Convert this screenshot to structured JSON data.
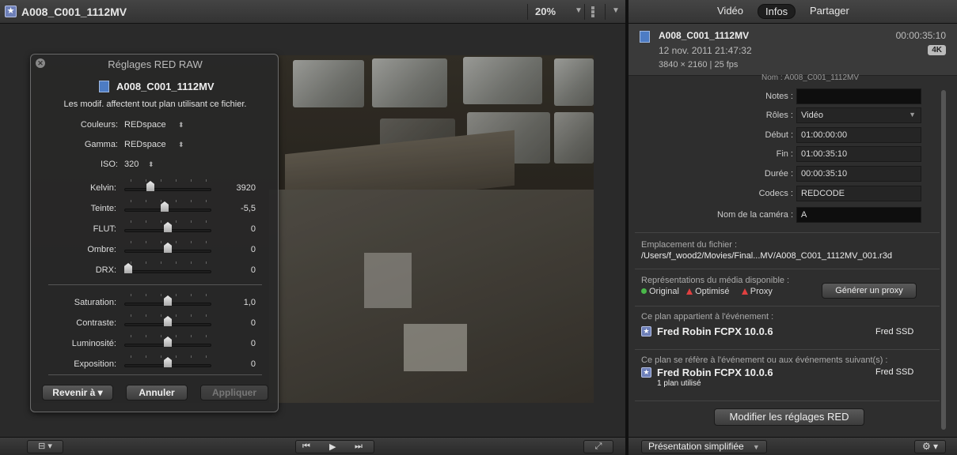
{
  "viewer": {
    "clip_title": "A008_C001_1112MV",
    "zoom": "20%",
    "zoom_arrow": "▼",
    "view_arrow": "▼"
  },
  "hud": {
    "title": "Réglages RED RAW",
    "clip_name": "A008_C001_1112MV",
    "note": "Les modif. affectent tout plan utilisant ce fichier.",
    "popups": [
      {
        "label": "Couleurs:",
        "value": "REDspace"
      },
      {
        "label": "Gamma:",
        "value": "REDspace"
      },
      {
        "label": "ISO:",
        "value": "320"
      }
    ],
    "sliders_top": [
      {
        "label": "Kelvin:",
        "value": "3920",
        "level": 0.28
      },
      {
        "label": "Teinte:",
        "value": "-5,5",
        "level": 0.46
      },
      {
        "label": "FLUT:",
        "value": "0",
        "level": 0.5
      },
      {
        "label": "Ombre:",
        "value": "0",
        "level": 0.5
      },
      {
        "label": "DRX:",
        "value": "0",
        "level": 0.0
      }
    ],
    "sliders_bottom": [
      {
        "label": "Saturation:",
        "value": "1,0",
        "level": 0.5
      },
      {
        "label": "Contraste:",
        "value": "0",
        "level": 0.5
      },
      {
        "label": "Luminosité:",
        "value": "0",
        "level": 0.5
      },
      {
        "label": "Exposition:",
        "value": "0",
        "level": 0.5
      }
    ],
    "revert_label": "Revenir à",
    "cancel_label": "Annuler",
    "apply_label": "Appliquer"
  },
  "inspector": {
    "tabs": [
      "Vidéo",
      "Infos",
      "Partager"
    ],
    "active_tab": "Infos",
    "clip_name": "A008_C001_1112MV",
    "duration": "00:00:35:10",
    "date": "12 nov. 2011 21:47:32",
    "resolution": "3840 × 2160 | 25 fps",
    "badge": "4K",
    "ghost_row": "Nom :  A008_C001_1112MV",
    "fields": [
      {
        "label": "Notes :",
        "value": "",
        "dark": true
      },
      {
        "label": "Rôles :",
        "value": "Vidéo",
        "popup": true
      },
      {
        "label": "Début :",
        "value": "01:00:00:00"
      },
      {
        "label": "Fin :",
        "value": "01:00:35:10"
      },
      {
        "label": "Durée :",
        "value": "00:00:35:10"
      },
      {
        "label": "Codecs :",
        "value": "REDCODE"
      },
      {
        "label": "Nom de la caméra :",
        "value": "A",
        "dark": true
      }
    ],
    "file_location_caption": "Emplacement du fichier :",
    "file_location": "/Users/f_wood2/Movies/Final...MV/A008_C001_1112MV_001.r3d",
    "media_caption": "Représentations du média disponible :",
    "media_original": "Original",
    "media_optimized": "Optimisé",
    "media_proxy": "Proxy",
    "proxy_button": "Générer un proxy",
    "event_caption": "Ce plan appartient à l'événement :",
    "event_name": "Fred Robin FCPX 10.0.6",
    "event_disk": "Fred SSD",
    "ref_caption": "Ce plan se réfère à l'événement ou aux événements suivant(s) :",
    "ref_event_name": "Fred Robin FCPX 10.0.6",
    "ref_event_disk": "Fred SSD",
    "ref_usage": "1 plan utilisé",
    "modify_button": "Modifier les réglages RED",
    "presentation": "Présentation simplifiée",
    "colors": {
      "star": "#6d7fb8",
      "film": "#4d7cc4",
      "original_dot": "#4ab84a",
      "warn_triangle": "#e04040"
    }
  }
}
